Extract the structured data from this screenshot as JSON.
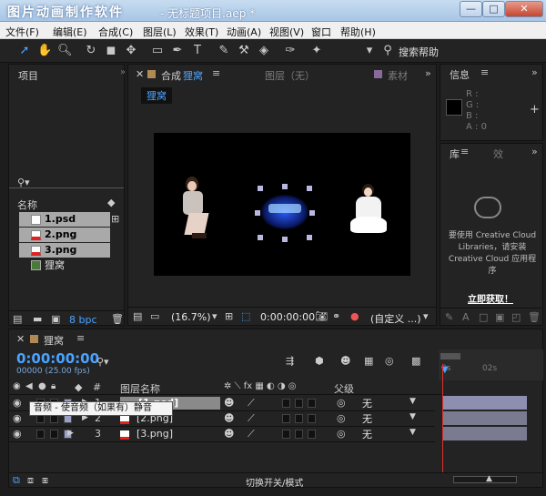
{
  "window": {
    "app_title": "图片动画制作软件",
    "doc_title": "- 无标题项目.aep *",
    "min": "—",
    "max": "□",
    "close": "✕"
  },
  "menu": [
    "文件(F)",
    "编辑(E)",
    "合成(C)",
    "图层(L)",
    "效果(T)",
    "动画(A)",
    "视图(V)",
    "窗口",
    "帮助(H)"
  ],
  "toolbar": {
    "search_help": "搜索帮助"
  },
  "project": {
    "title": "项目",
    "column_name": "名称",
    "files": [
      "1.psd",
      "2.png",
      "3.png",
      "狸窝"
    ],
    "bpc": "8 bpc"
  },
  "comp": {
    "tab_prefix": "合成",
    "tab_name": "狸窝",
    "layer_tab": "图层（无）",
    "footage_tab": "素材",
    "flow_tab": "狸窝",
    "zoom": "(16.7%)",
    "timecode": "0:00:00:00",
    "view": "(自定义 ...)"
  },
  "info": {
    "title": "信息",
    "r": "R :",
    "g": "G :",
    "b": "B :",
    "a": "A : 0",
    "add": "+"
  },
  "library": {
    "tab": "库",
    "effects_tab": "效",
    "message": "要使用 Creative Cloud Libraries，请安装 Creative Cloud 应用程序",
    "cta": "立即获取！"
  },
  "timeline": {
    "tab": "狸窝",
    "timecode": "0:00:00:00",
    "fps": "00000 (25.00 fps)",
    "col_num": "#",
    "col_name": "图层名称",
    "col_parent": "父级",
    "tooltip": "音频 - 使音频（如果有）静音",
    "ruler_0": "0s",
    "ruler_1": "02s",
    "toggle_label": "切换开关/模式",
    "layers": [
      {
        "num": "1",
        "name": "[1.psd]",
        "parent": "无"
      },
      {
        "num": "2",
        "name": "[2.png]",
        "parent": "无"
      },
      {
        "num": "3",
        "name": "[3.png]",
        "parent": "无"
      }
    ]
  }
}
